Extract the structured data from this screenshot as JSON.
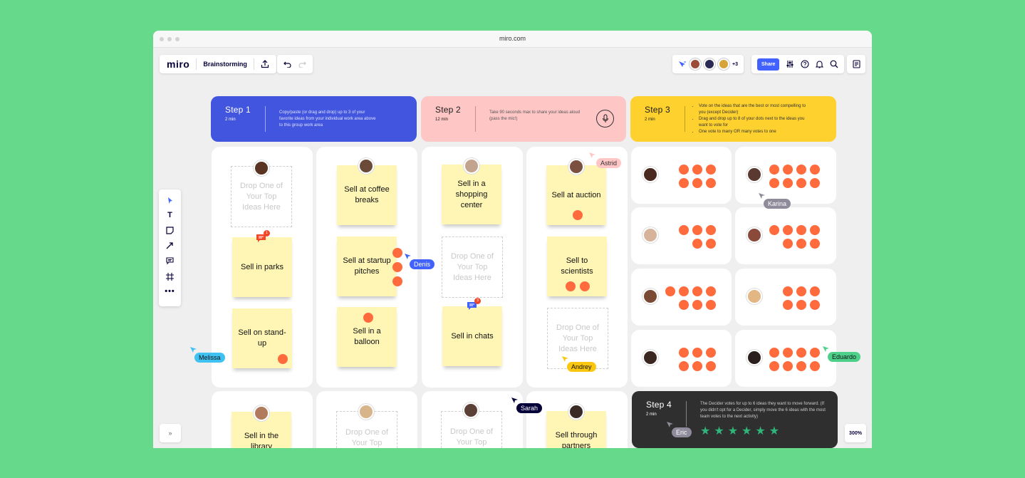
{
  "browser": {
    "url": "miro.com"
  },
  "app": {
    "logo": "miro",
    "board_name": "Brainstorming",
    "extra_users": "+3",
    "share_label": "Share",
    "zoom": "300%"
  },
  "steps": [
    {
      "title": "Step 1",
      "duration": "2 min",
      "description": "Copy/paste (or drag and drop) up to 3 of your favorite ideas from your individual work area above to this group work area"
    },
    {
      "title": "Step 2",
      "duration": "12 min",
      "description": "Take 90 seconds max to share your ideas aloud (pass the mic!)"
    },
    {
      "title": "Step 3",
      "duration": "2 min",
      "bullets": [
        "Vote on the ideas that are the best or most compelling to you (except Decider)",
        "Drag and drop up to 8 of your dots next to the ideas you want to vote for",
        "One vote to many OR many votes to one"
      ]
    },
    {
      "title": "Step 4",
      "duration": "2 min",
      "description": "The Decider votes for up to 6 ideas they want to move forward. (If you didn't opt for a Decider, simply move the 6 ideas with the most team votes to the next activity)"
    }
  ],
  "drop_placeholder": "Drop One of Your Top Ideas Here",
  "drop_placeholder_partial": "Drop One of Your Top",
  "notes": {
    "parks": "Sell in parks",
    "standup": "Sell on stand-up",
    "coffee": "Sell at coffee breaks",
    "startup": "Sell at startup pitches",
    "balloon": "Sell in a balloon",
    "shopping": "Sell in a shopping center",
    "chats": "Sell in chats",
    "auction": "Sell at auction",
    "scientists": "Sell to scientists",
    "library": "Sell in the library",
    "partners": "Sell through partners"
  },
  "comment_counts": {
    "parks": "1",
    "chats": "3"
  },
  "cursors": {
    "astrid": {
      "name": "Astrid",
      "color": "#ffc6c6"
    },
    "karina": {
      "name": "Karina",
      "color": "#8f8b9a"
    },
    "denis": {
      "name": "Denis",
      "color": "#4262ff"
    },
    "melissa": {
      "name": "Melissa",
      "color": "#3fc2f2"
    },
    "andrey": {
      "name": "Andrey",
      "color": "#fac710"
    },
    "eduardo": {
      "name": "Eduardo",
      "color": "#4ed08a"
    },
    "sarah": {
      "name": "Sarah",
      "color": "#050038"
    },
    "eric": {
      "name": "Eric",
      "color": "#8f8b9a"
    }
  },
  "votes": [
    6,
    8,
    5,
    7,
    7,
    6,
    6,
    8
  ],
  "stars": 6,
  "colors": {
    "step1": "#4255de",
    "step2": "#ffc6c6",
    "step3": "#fed12e",
    "step4": "#2f2f2f",
    "vote_dot": "#ff6b3d",
    "sticky": "#fff6b6",
    "background": "#67d98a"
  }
}
